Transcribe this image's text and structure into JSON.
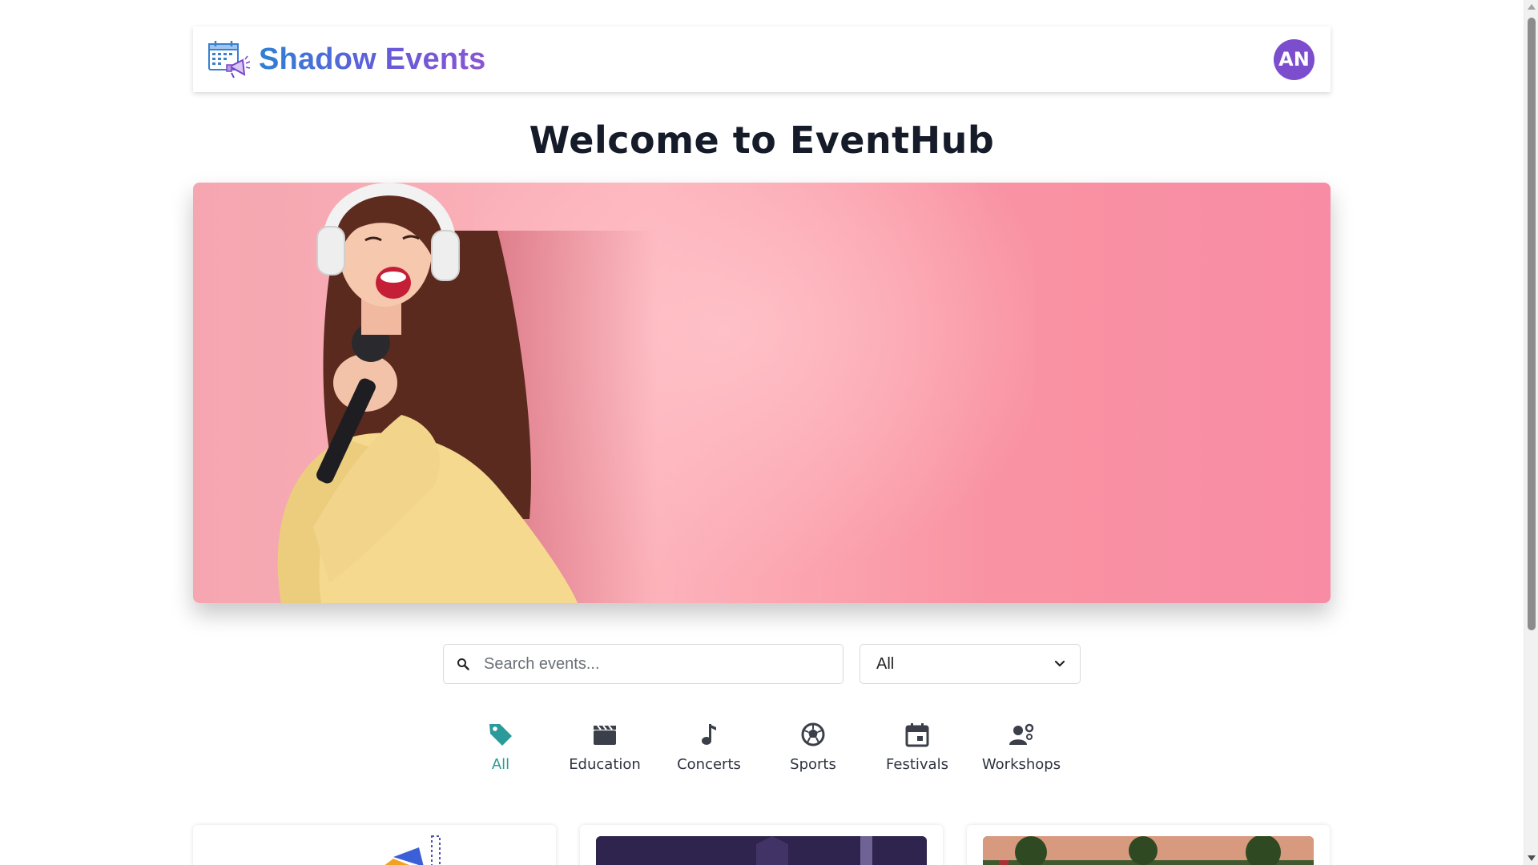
{
  "header": {
    "brand_name": "Shadow Events",
    "avatar_initials": "AN"
  },
  "page": {
    "title": "Welcome to EventHub"
  },
  "search": {
    "placeholder": "Search events...",
    "value": ""
  },
  "filter": {
    "selected": "All"
  },
  "categories": [
    {
      "label": "All",
      "icon": "tag-icon",
      "active": true
    },
    {
      "label": "Education",
      "icon": "clapperboard-icon",
      "active": false
    },
    {
      "label": "Concerts",
      "icon": "music-note-icon",
      "active": false
    },
    {
      "label": "Sports",
      "icon": "soccer-ball-icon",
      "active": false
    },
    {
      "label": "Festivals",
      "icon": "calendar-icon",
      "active": false
    },
    {
      "label": "Workshops",
      "icon": "person-gear-icon",
      "active": false
    }
  ],
  "colors": {
    "brand_gradient_start": "#2f7fd6",
    "brand_gradient_end": "#8a55d2",
    "avatar_bg": "#7c4dcc",
    "active_category": "#2a9a9a",
    "hero_pink": "#f993a3"
  }
}
